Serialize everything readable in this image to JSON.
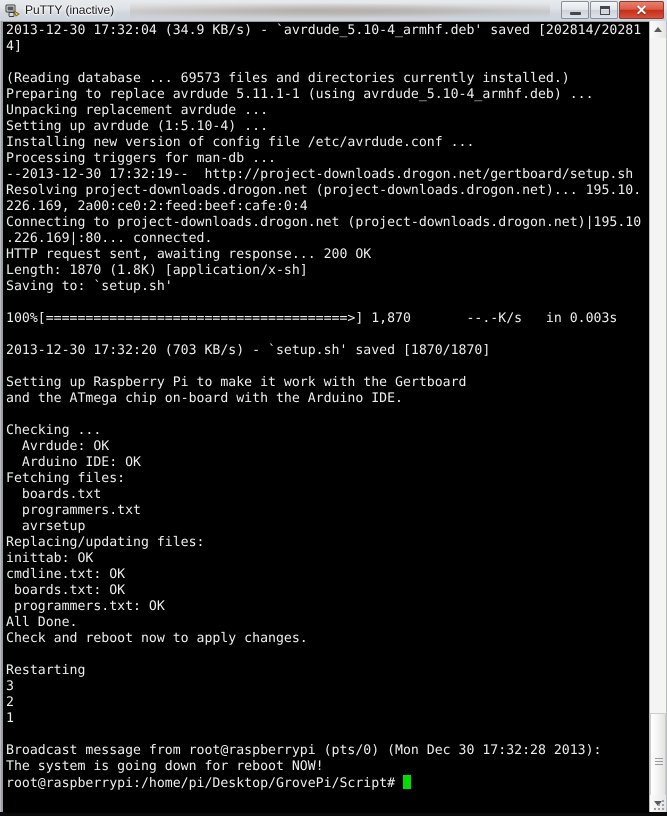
{
  "window": {
    "title": "PuTTY (inactive)",
    "icon": "putty-icon",
    "controls": {
      "minimize_label": "Minimize",
      "maximize_label": "Maximize",
      "close_label": "✕"
    }
  },
  "terminal": {
    "foreground_color": "#eeeeee",
    "background_color": "#000000",
    "cursor_color": "#00dd00",
    "font_size_px": 13.2,
    "line_height_px": 16,
    "columns": 80,
    "prompt": "root@raspberrypi:/home/pi/Desktop/GrovePi/Script#",
    "lines": [
      "2013-12-30 17:32:04 (34.9 KB/s) - `avrdude_5.10-4_armhf.deb' saved [202814/20281",
      "4]",
      "",
      "(Reading database ... 69573 files and directories currently installed.)",
      "Preparing to replace avrdude 5.11.1-1 (using avrdude_5.10-4_armhf.deb) ...",
      "Unpacking replacement avrdude ...",
      "Setting up avrdude (1:5.10-4) ...",
      "Installing new version of config file /etc/avrdude.conf ...",
      "Processing triggers for man-db ...",
      "--2013-12-30 17:32:19--  http://project-downloads.drogon.net/gertboard/setup.sh",
      "Resolving project-downloads.drogon.net (project-downloads.drogon.net)... 195.10.",
      "226.169, 2a00:ce0:2:feed:beef:cafe:0:4",
      "Connecting to project-downloads.drogon.net (project-downloads.drogon.net)|195.10",
      ".226.169|:80... connected.",
      "HTTP request sent, awaiting response... 200 OK",
      "Length: 1870 (1.8K) [application/x-sh]",
      "Saving to: `setup.sh'",
      "",
      "100%[======================================>] 1,870       --.-K/s   in 0.003s",
      "",
      "2013-12-30 17:32:20 (703 KB/s) - `setup.sh' saved [1870/1870]",
      "",
      "Setting up Raspberry Pi to make it work with the Gertboard",
      "and the ATmega chip on-board with the Arduino IDE.",
      "",
      "Checking ...",
      "  Avrdude: OK",
      "  Arduino IDE: OK",
      "Fetching files:",
      "  boards.txt",
      "  programmers.txt",
      "  avrsetup",
      "Replacing/updating files:",
      "inittab: OK",
      "cmdline.txt: OK",
      " boards.txt: OK",
      " programmers.txt: OK",
      "All Done.",
      "Check and reboot now to apply changes.",
      "",
      "Restarting",
      "3",
      "2",
      "1",
      "",
      "Broadcast message from root@raspberrypi (pts/0) (Mon Dec 30 17:32:28 2013):",
      "The system is going down for reboot NOW!"
    ]
  },
  "scrollbar": {
    "up_arrow": "scroll-up-arrow",
    "down_arrow": "scroll-down-arrow",
    "thumb": "scroll-thumb"
  }
}
